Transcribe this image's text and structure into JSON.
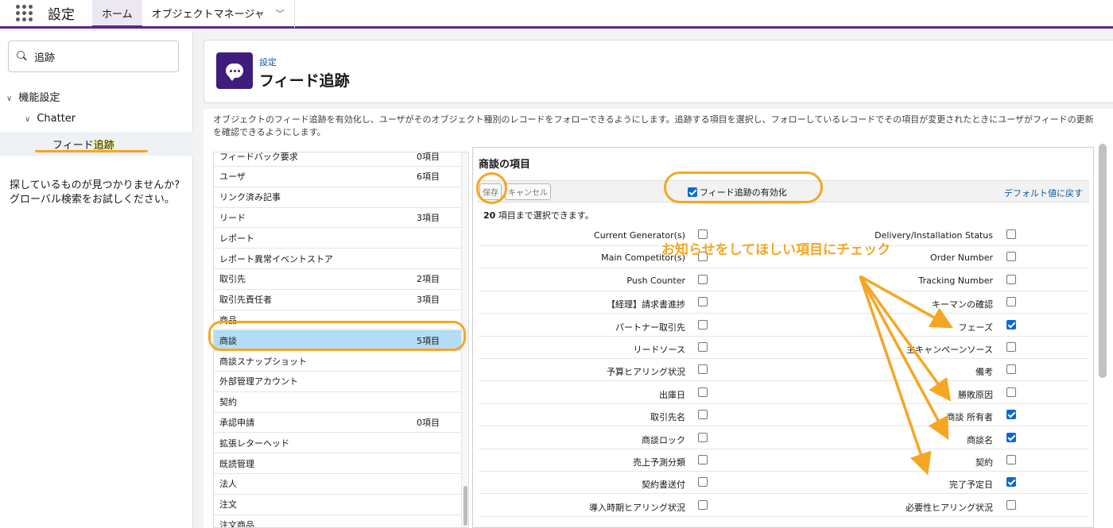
{
  "topbar": {
    "app_name": "設定",
    "tabs": [
      {
        "label": "ホーム"
      },
      {
        "label": "オブジェクトマネージャ"
      }
    ]
  },
  "sidebar": {
    "search_value": "追跡",
    "tree": {
      "root": "機能設定",
      "child": "Chatter",
      "leaf_prefix": "フィード",
      "leaf_highlight": "追跡"
    },
    "help_line1": "探しているものが見つかりませんか?",
    "help_line2": "グローバル検索をお試しください。"
  },
  "header": {
    "breadcrumb": "設定",
    "title": "フィード追跡"
  },
  "description": "オブジェクトのフィード追跡を有効化し、ユーザがそのオブジェクト種別のレコードをフォローできるようにします。追跡する項目を選択し、フォローしているレコードでその項目が変更されたときにユーザがフィードの更新を確認できるようにします。",
  "objects": [
    {
      "name": "フィードバック要求",
      "count": "0項目"
    },
    {
      "name": "ユーザ",
      "count": "6項目"
    },
    {
      "name": "リンク済み記事",
      "count": ""
    },
    {
      "name": "リード",
      "count": "3項目"
    },
    {
      "name": "レポート",
      "count": ""
    },
    {
      "name": "レポート異常イベントストア",
      "count": ""
    },
    {
      "name": "取引先",
      "count": "2項目"
    },
    {
      "name": "取引先責任者",
      "count": "3項目"
    },
    {
      "name": "商品",
      "count": ""
    },
    {
      "name": "商談",
      "count": "5項目"
    },
    {
      "name": "商談スナップショット",
      "count": ""
    },
    {
      "name": "外部管理アカウント",
      "count": ""
    },
    {
      "name": "契約",
      "count": ""
    },
    {
      "name": "承認申請",
      "count": "0項目"
    },
    {
      "name": "拡張レターヘッド",
      "count": ""
    },
    {
      "name": "既読管理",
      "count": ""
    },
    {
      "name": "法人",
      "count": ""
    },
    {
      "name": "注文",
      "count": ""
    },
    {
      "name": "注文商品",
      "count": ""
    }
  ],
  "panel": {
    "title": "商談の項目",
    "save_label": "保存",
    "cancel_label": "キャンセル",
    "enable_label": "フィード追跡の有効化",
    "enable_checked": true,
    "reset_label": "デフォルト値に戻す",
    "limit_number": "20",
    "limit_text": " 項目まで選択できます。"
  },
  "fields": [
    {
      "left": "Current Generator(s)",
      "left_checked": false,
      "right": "Delivery/Installation Status",
      "right_checked": false
    },
    {
      "left": "Main Competitor(s)",
      "left_checked": false,
      "right": "Order Number",
      "right_checked": false
    },
    {
      "left": "Push Counter",
      "left_checked": false,
      "right": "Tracking Number",
      "right_checked": false
    },
    {
      "left": "【経理】請求書進捗",
      "left_checked": false,
      "right": "キーマンの確認",
      "right_checked": false
    },
    {
      "left": "パートナー取引先",
      "left_checked": false,
      "right": "フェーズ",
      "right_checked": true
    },
    {
      "left": "リードソース",
      "left_checked": false,
      "right": "主キャンペーンソース",
      "right_checked": false
    },
    {
      "left": "予算ヒアリング状況",
      "left_checked": false,
      "right": "備考",
      "right_checked": false
    },
    {
      "left": "出庫日",
      "left_checked": false,
      "right": "勝敗原因",
      "right_checked": false
    },
    {
      "left": "取引先名",
      "left_checked": false,
      "right": "商談 所有者",
      "right_checked": true
    },
    {
      "left": "商談ロック",
      "left_checked": false,
      "right": "商談名",
      "right_checked": true
    },
    {
      "left": "売上予測分類",
      "left_checked": false,
      "right": "契約",
      "right_checked": false
    },
    {
      "left": "契約書送付",
      "left_checked": false,
      "right": "完了予定日",
      "right_checked": true
    },
    {
      "left": "導入時期ヒアリング状況",
      "left_checked": false,
      "right": "必要性ヒアリング状況",
      "right_checked": false
    }
  ],
  "annotation": {
    "text": "お知らせをしてほしい項目にチェック",
    "color": "#f5a623"
  },
  "colors": {
    "brand": "#5a2a86",
    "link": "#0b5cab",
    "selected_row": "#b3dcf7",
    "checkbox_on": "#0b69d4"
  }
}
